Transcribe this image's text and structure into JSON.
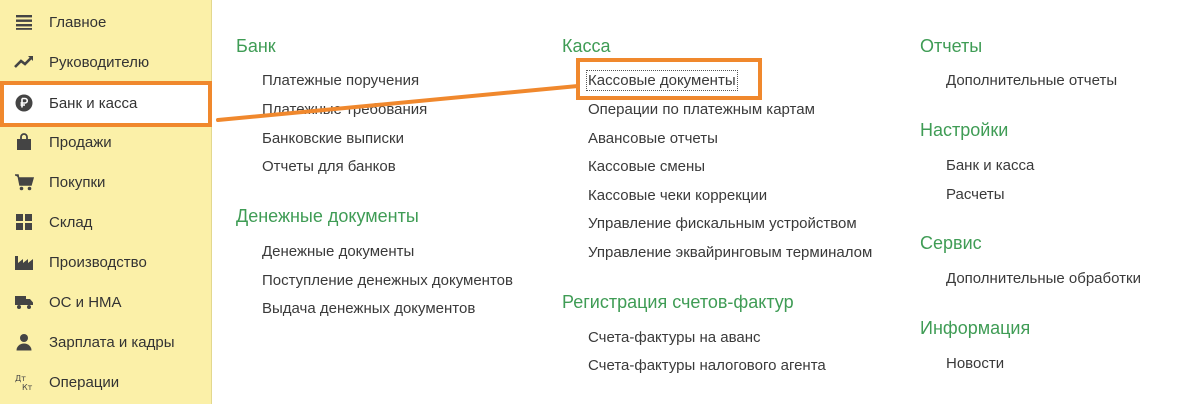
{
  "sidebar": {
    "items": [
      {
        "label": "Главное",
        "icon": "list-icon"
      },
      {
        "label": "Руководителю",
        "icon": "trend-icon"
      },
      {
        "label": "Банк и касса",
        "icon": "ruble-coin-icon"
      },
      {
        "label": "Продажи",
        "icon": "shopping-bag-icon"
      },
      {
        "label": "Покупки",
        "icon": "cart-icon"
      },
      {
        "label": "Склад",
        "icon": "warehouse-icon"
      },
      {
        "label": "Производство",
        "icon": "factory-icon"
      },
      {
        "label": "ОС и НМА",
        "icon": "truck-icon"
      },
      {
        "label": "Зарплата и кадры",
        "icon": "person-icon"
      },
      {
        "label": "Операции",
        "icon": "dt-kt-icon"
      }
    ],
    "active_index": 2,
    "dt_kt_icon_text": [
      "Дт",
      "Кт"
    ]
  },
  "sections": {
    "bank": {
      "title": "Банк",
      "links": [
        "Платежные поручения",
        "Платежные требования",
        "Банковские выписки",
        "Отчеты для банков"
      ]
    },
    "money_docs": {
      "title": "Денежные документы",
      "links": [
        "Денежные документы",
        "Поступление денежных документов",
        "Выдача денежных документов"
      ]
    },
    "kassa": {
      "title": "Касса",
      "links": [
        "Кассовые документы",
        "Операции по платежным картам",
        "Авансовые отчеты",
        "Кассовые смены",
        "Кассовые чеки коррекции",
        "Управление фискальным устройством",
        "Управление эквайринговым терминалом"
      ]
    },
    "invoices": {
      "title": "Регистрация счетов-фактур",
      "links": [
        "Счета-фактуры на аванс",
        "Счета-фактуры налогового агента"
      ]
    },
    "reports": {
      "title": "Отчеты",
      "links": [
        "Дополнительные отчеты"
      ]
    },
    "settings": {
      "title": "Настройки",
      "links": [
        "Банк и касса",
        "Расчеты"
      ]
    },
    "service": {
      "title": "Сервис",
      "links": [
        "Дополнительные обработки"
      ]
    },
    "info": {
      "title": "Информация",
      "links": [
        "Новости"
      ]
    }
  },
  "colors": {
    "sidebar_bg": "#fbf0a8",
    "section_title": "#3f9c55",
    "highlight": "#f0882d",
    "icon": "#444444"
  }
}
